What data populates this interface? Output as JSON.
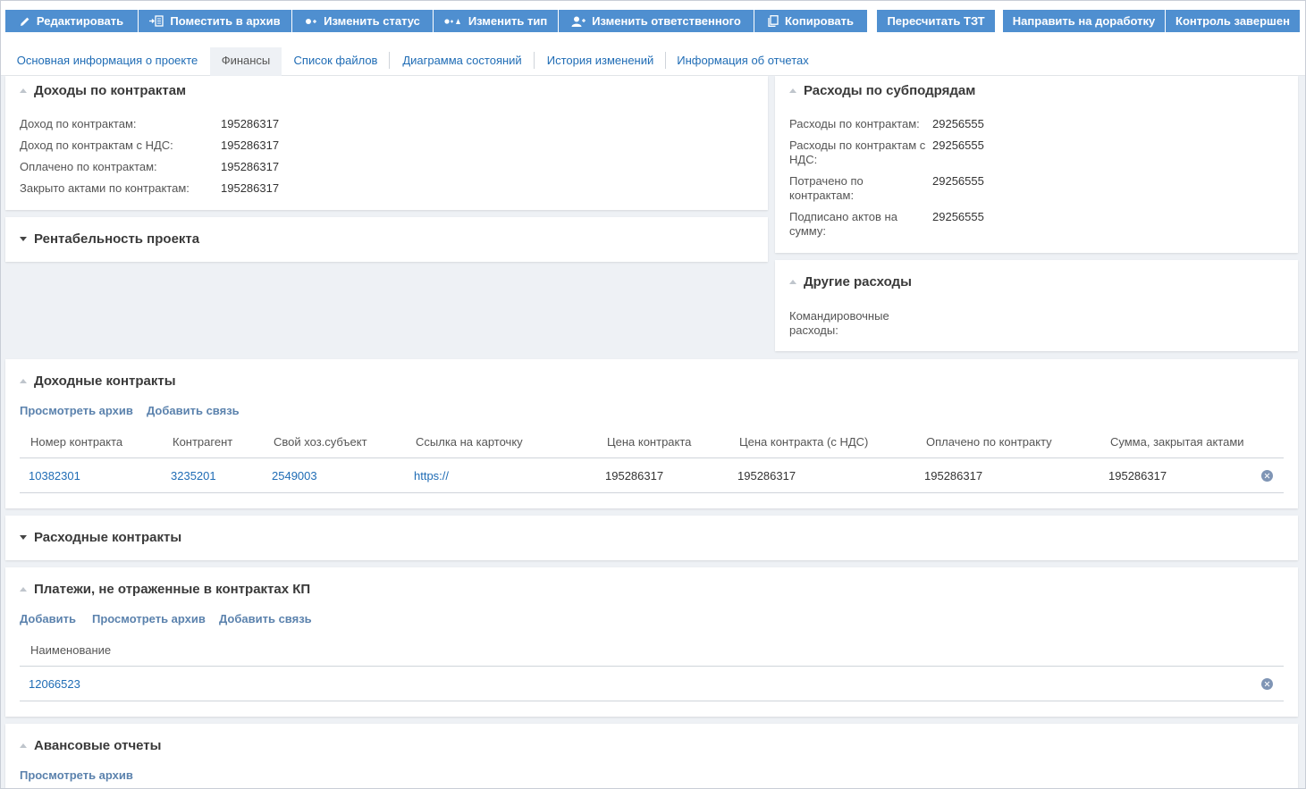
{
  "toolbar": {
    "edit": "Редактировать",
    "archive": "Поместить в архив",
    "change_status": "Изменить статус",
    "change_type": "Изменить тип",
    "change_responsible": "Изменить ответственного",
    "copy": "Копировать",
    "recalc": "Пересчитать ТЗТ",
    "send_rework": "Направить на доработку",
    "control_done": "Контроль завершен",
    "button_color": "#4f8fd0"
  },
  "tabs": [
    {
      "label": "Основная информация о проекте"
    },
    {
      "label": "Финансы",
      "active": true
    },
    {
      "label": "Список файлов"
    },
    {
      "label": "Диаграмма состояний"
    },
    {
      "label": "История изменений"
    },
    {
      "label": "Информация об отчетах"
    }
  ],
  "income": {
    "title": "Доходы по контрактам",
    "rows": [
      {
        "label": "Доход по контрактам:",
        "value": "195286317"
      },
      {
        "label": "Доход по контрактам с НДС:",
        "value": "195286317"
      },
      {
        "label": "Оплачено по контрактам:",
        "value": "195286317"
      },
      {
        "label": "Закрыто актами по контрактам:",
        "value": "195286317"
      }
    ]
  },
  "profitability": {
    "title": "Рентабельность проекта"
  },
  "subcontract": {
    "title": "Расходы по субподрядам",
    "rows": [
      {
        "label": "Расходы по контрактам:",
        "value": "29256555"
      },
      {
        "label": "Расходы по контрактам с НДС:",
        "value": "29256555"
      },
      {
        "label": "Потрачено по контрактам:",
        "value": "29256555"
      },
      {
        "label": "Подписано актов на сумму:",
        "value": "29256555"
      }
    ]
  },
  "other_expenses": {
    "title": "Другие расходы",
    "rows": [
      {
        "label": "Командировочные расходы:",
        "value": ""
      }
    ]
  },
  "income_contracts": {
    "title": "Доходные контракты",
    "actions": [
      "Просмотреть архив",
      "Добавить связь"
    ],
    "columns": [
      "Номер контракта",
      "Контрагент",
      "Свой хоз.субъект",
      "Ссылка на карточку",
      "Цена контракта",
      "Цена контракта (с НДС)",
      "Оплачено по контракту",
      "Сумма, закрытая актами"
    ],
    "rows": [
      [
        "10382301",
        "3235201",
        "2549003",
        "https://",
        "195286317",
        "195286317",
        "195286317",
        "195286317"
      ]
    ]
  },
  "expense_contracts": {
    "title": "Расходные контракты"
  },
  "payments": {
    "title": "Платежи, не отраженные в контрактах КП",
    "actions": [
      "Добавить",
      "Просмотреть архив",
      "Добавить связь"
    ],
    "columns": [
      "Наименование"
    ],
    "rows": [
      [
        "12066523"
      ]
    ]
  },
  "advance_reports": {
    "title": "Авансовые отчеты",
    "actions": [
      "Просмотреть архив"
    ]
  }
}
